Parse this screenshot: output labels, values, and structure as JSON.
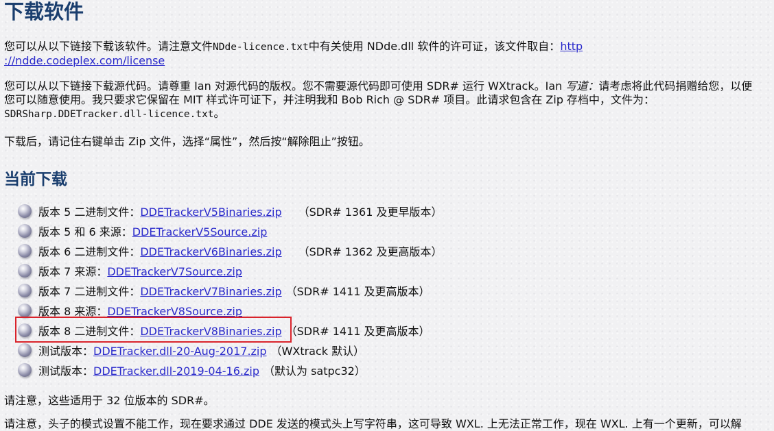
{
  "heading_main": "下载软件",
  "heading_current": "当前下载",
  "p1": {
    "text_a": "您可以从以下链接下载该软件。请注意文件",
    "mono_file": "NDde-licence.txt",
    "text_b": "中有关使用 NDde.dll 软件的许可证，该文件取自：",
    "link_part1": "http",
    "link_part2": "://ndde.codeplex.com/license"
  },
  "p2": {
    "line1_a": "您可以从以下链接下载源代码。请尊重 Ian 对源代码的版权。您不需要源代码即可使用 SDR# 运行 WXtrack。Ian ",
    "line1_em": "写道：",
    "line1_b": "请考虑将此代码捐赠给您，以便",
    "line2": "您可以随意使用。我只要求它保留在 MIT 样式许可证下，并注明我和 Bob Rich @ SDR# 项目。此请求包含在 Zip 存档中，文件为：",
    "line3_mono": "SDRSharp.DDETracker.dll-licence.txt",
    "line3_end": "。"
  },
  "p3": "下载后，请记住右键单击 Zip 文件，选择“属性”，然后按“解除阻止”按钮。",
  "downloads": [
    {
      "label": "版本 5 二进制文件：",
      "link": "DDETrackerV5Binaries.zip",
      "note": "（SDR# 1361 及更早版本）"
    },
    {
      "label": "版本 5 和 6 来源：",
      "link": "DDETrackerV5Source.zip",
      "note": ""
    },
    {
      "label": "版本 6 二进制文件：",
      "link": "DDETrackerV6Binaries.zip",
      "note": "（SDR# 1362 及更高版本）"
    },
    {
      "label": "版本 7 来源：",
      "link": "DDETrackerV7Source.zip",
      "note": ""
    },
    {
      "label": "版本 7 二进制文件：",
      "link": "DDETrackerV7Binaries.zip",
      "note": "（SDR# 1411 及更高版本）"
    },
    {
      "label": "版本 8 来源：",
      "link": "DDETrackerV8Source.zip",
      "note": ""
    },
    {
      "label": "版本 8 二进制文件：",
      "link": "DDETrackerV8Binaries.zip",
      "note": "（SDR# 1411 及更高版本）"
    },
    {
      "label": "测试版本：",
      "link": "DDETracker.dll-20-Aug-2017.zip",
      "note": "（WXtrack 默认）"
    },
    {
      "label": "测试版本：",
      "link": "DDETracker.dll-2019-04-16.zip",
      "note": "（默认为 satpc32）"
    }
  ],
  "p4": "请注意，这些适用于 32 位版本的 SDR#。",
  "p5": "请注意，头子的模式设置不能工作，现在要求通过 DDE 发送的模式头上写字符串，这可导致 WXL. 上无法正常工作，现在 WXL. 上有一个更新，可以解",
  "accent_colors": {
    "heading": "#1a3e6e",
    "link": "#2a2acb",
    "highlight": "#d9232b"
  }
}
